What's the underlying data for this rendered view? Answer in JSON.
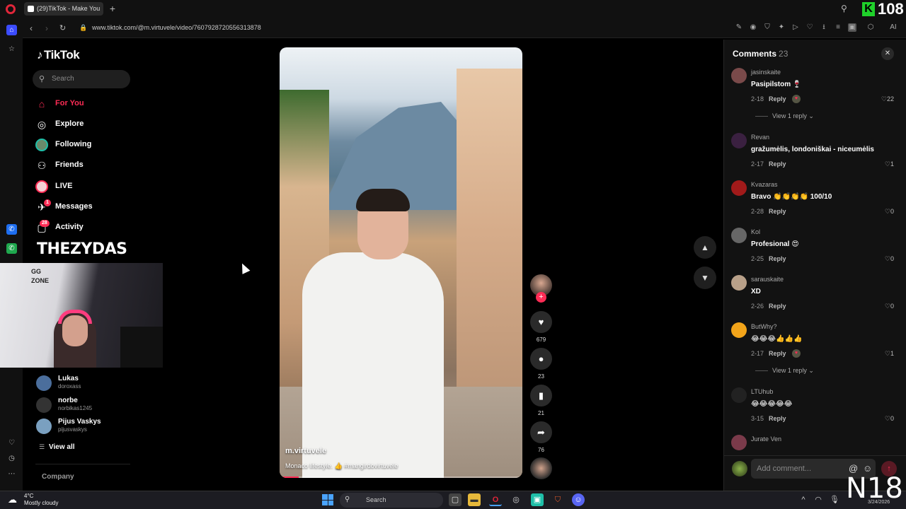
{
  "browser": {
    "tab_title": "(29)TikTok - Make You",
    "url": "www.tiktok.com/@m.virtuvele/video/7607928720556313878",
    "ext_badge": "K",
    "ai_label": "AI"
  },
  "overlay": {
    "counter": "108",
    "streamer_text": "THEZYDAS",
    "webcam_text": "GG\nZONE",
    "age_rating": "N18"
  },
  "tiktok": {
    "logo": "TikTok",
    "search_placeholder": "Search",
    "nav": [
      {
        "label": "For You",
        "icon": "home-icon"
      },
      {
        "label": "Explore",
        "icon": "compass-icon"
      },
      {
        "label": "Following",
        "icon": "following-avatar-icon"
      },
      {
        "label": "Friends",
        "icon": "friends-icon"
      },
      {
        "label": "LIVE",
        "icon": "live-icon"
      },
      {
        "label": "Messages",
        "icon": "messages-icon",
        "badge": "1"
      },
      {
        "label": "Activity",
        "icon": "activity-icon",
        "badge": "28"
      }
    ],
    "following_accounts": [
      {
        "name": "Lukas",
        "username": "doroxass"
      },
      {
        "name": "norbe",
        "username": "norbikas1245"
      },
      {
        "name": "Pijus Vaskys",
        "username": "pijusvaskys"
      }
    ],
    "view_all": "View all",
    "company": "Company"
  },
  "video": {
    "author": "m.virtuvele",
    "caption": "Monaco lifestyle. 👍 #mangirdovirtuvele",
    "progress": 0.08,
    "likes": "679",
    "comments": "23",
    "saves": "21",
    "shares": "76"
  },
  "comments_panel": {
    "title": "Comments",
    "count": "23",
    "items": [
      {
        "user": "jasinskaite",
        "text": "Pasipilstom 🍷",
        "date": "2-18",
        "reply": "Reply",
        "likes": "22",
        "view_replies": "View 1 reply",
        "avatar_color": "#7a4a4a"
      },
      {
        "user": "Revan",
        "text": "gražumėlis, londoniškai - niceumėlis",
        "date": "2-17",
        "reply": "Reply",
        "likes": "1",
        "avatar_color": "#3a2040"
      },
      {
        "user": "Kvazaras",
        "text": "Bravo 👏👏👏👏 100/10",
        "date": "2-28",
        "reply": "Reply",
        "likes": "0",
        "avatar_color": "#a11a1a"
      },
      {
        "user": "Kol",
        "text": "Profesional 😍",
        "date": "2-25",
        "reply": "Reply",
        "likes": "0",
        "avatar_color": "#666666"
      },
      {
        "user": "sarauskaite",
        "text": "XD",
        "date": "2-26",
        "reply": "Reply",
        "likes": "0",
        "avatar_color": "#b8a089"
      },
      {
        "user": "ButWhy?",
        "text": "😂😂😂👍👍👍",
        "date": "2-17",
        "reply": "Reply",
        "likes": "1",
        "view_replies": "View 1 reply",
        "avatar_color": "#f2a41a"
      },
      {
        "user": "LTUhub",
        "text": "😂😂😂😂😂",
        "date": "3-15",
        "reply": "Reply",
        "likes": "0",
        "avatar_color": "#222222"
      },
      {
        "user": "Jurate Ven",
        "text": "",
        "date": "",
        "reply": "",
        "likes": "",
        "avatar_color": "#7a3a4a"
      }
    ],
    "add_placeholder": "Add comment..."
  },
  "taskbar": {
    "temp": "4°C",
    "condition": "Mostly cloudy",
    "search": "Search",
    "date": "3/24/2026"
  },
  "colors": {
    "accent": "#fe2c55",
    "background": "#000000",
    "panel": "#121212"
  }
}
